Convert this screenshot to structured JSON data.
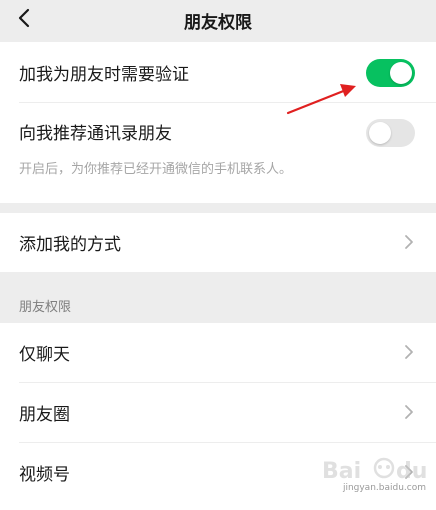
{
  "nav": {
    "title": "朋友权限",
    "back_icon": "chevron-left-icon"
  },
  "verification": {
    "require_verify_label": "加我为朋友时需要验证",
    "require_verify_on": true,
    "recommend_contacts_label": "向我推荐通讯录朋友",
    "recommend_contacts_on": false,
    "recommend_hint": "开启后，为你推荐已经开通微信的手机联系人。"
  },
  "add_methods": {
    "label": "添加我的方式"
  },
  "friend_permissions": {
    "header": "朋友权限",
    "items": [
      {
        "label": "仅聊天"
      },
      {
        "label": "朋友圈"
      },
      {
        "label": "视频号"
      }
    ]
  },
  "watermark": {
    "text": "jingyan.baidu.com"
  },
  "colors": {
    "toggle_on": "#07c160",
    "toggle_off": "#e5e5e5",
    "annotation_arrow": "#e02020"
  }
}
